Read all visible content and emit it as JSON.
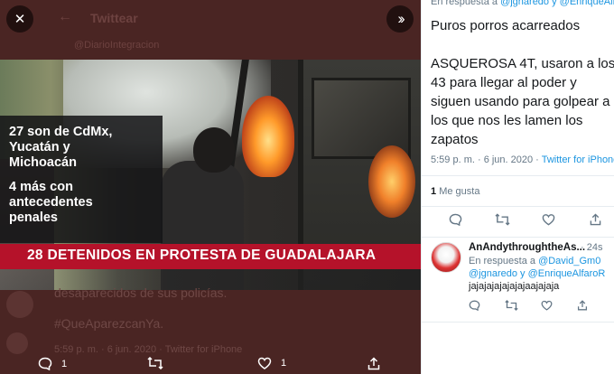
{
  "colors": {
    "viewer_bg": "#4a2523",
    "link": "#1b95e0",
    "banner": "#b5122a",
    "muted": "#657786"
  },
  "viewer": {
    "dim_title": "Twittear",
    "dim_subtitle": "@DiarioIntegracion",
    "video_caption_lines": [
      "27 son de CdMx,",
      "Yucatán y",
      "Michoacán",
      "4 más con",
      "antecedentes",
      "penales"
    ],
    "banner_text": "28 DETENIDOS EN PROTESTA DE GUADALAJARA",
    "dim_text_1": "desaparecidos de sus policías.",
    "dim_text_2": "#QueAparezcanYa.",
    "dim_text_3": "5:59 p. m. · 6 jun. 2020 · Twitter for iPhone",
    "actions": {
      "reply_icon": "reply-icon",
      "reply_count": "1",
      "retweet_icon": "retweet-icon",
      "like_icon": "heart-icon",
      "like_count": "1",
      "share_icon": "share-icon"
    }
  },
  "panel": {
    "reply_prefix": "En respuesta a",
    "reply_handles": "@jgnaredo y @EnriqueAlfaro",
    "text_para_1": "Puros porros acarreados",
    "text_para_2": [
      "ASQUEROSA 4T, usaron a los",
      "43 para llegar al poder y",
      "siguen usando para golpear a",
      "los que nos les lamen los",
      "zapatos"
    ],
    "meta_time": "5:59 p. m. · 6 jun. 2020 · ",
    "meta_source": "Twitter for iPhone",
    "likes_count": "1",
    "likes_label": "Me gusta",
    "reply": {
      "name": "AnAndythroughtheAs...",
      "time": "· 24s",
      "prefix": "En respuesta a",
      "handle_1": "@David_Gm0",
      "handles_2": "@jgnaredo y @EnriqueAlfaroR",
      "body": "jajajajajajajajaajajaja"
    }
  }
}
